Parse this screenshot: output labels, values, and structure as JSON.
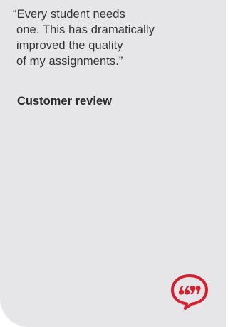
{
  "review": {
    "quote_lines": [
      "“Every student needs",
      "one. This has dramatically",
      "improved the quality",
      "of my assignments.”"
    ],
    "source": "Customer review"
  },
  "badge": {
    "icon": "quote-bubble-icon",
    "glyph": "“,,”"
  },
  "colors": {
    "card_background": "#e6e6e8",
    "accent": "#d6202f",
    "text": "#333333"
  }
}
